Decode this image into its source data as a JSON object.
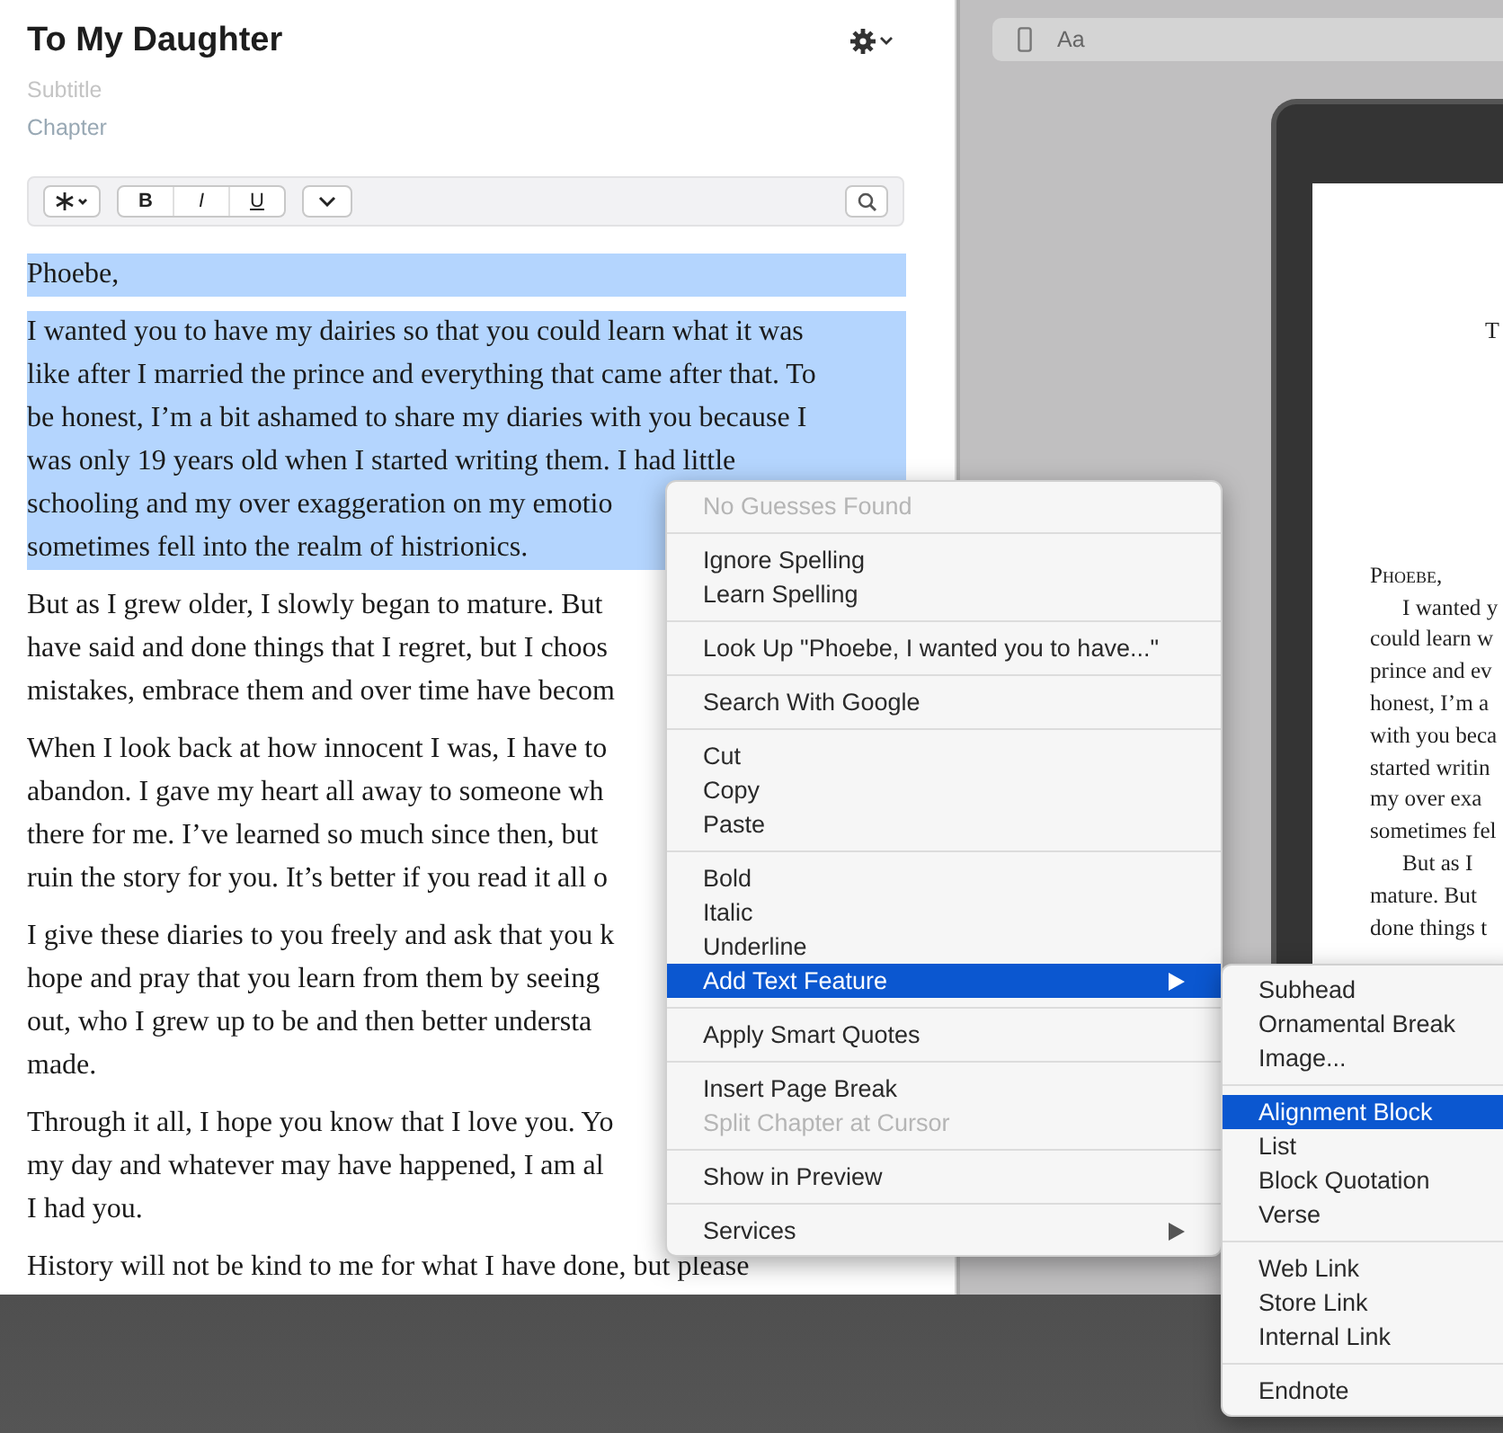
{
  "editor": {
    "title": "To My Daughter",
    "subtitle_placeholder": "Subtitle",
    "chapter": "Chapter",
    "toolbar": {
      "bold": "B",
      "italic": "I",
      "underline": "U"
    },
    "paragraphs": [
      {
        "selected": true,
        "lines": [
          "Phoebe,"
        ]
      },
      {
        "selected": true,
        "lines": [
          "I wanted you to have my dairies so that you could learn what it was",
          "like after I married the prince and everything that came after that. To",
          "be honest, I’m a bit ashamed to share my diaries with you because I",
          "was only 19 years old when I started writing them. I had little",
          "schooling and my over exaggeration on my emotio",
          "sometimes fell into the realm of histrionics."
        ]
      },
      {
        "selected": false,
        "lines": [
          "But as I grew older, I slowly began to mature. But",
          "have said and done things that I regret, but I choos",
          "mistakes, embrace them and over time have becom"
        ]
      },
      {
        "selected": false,
        "lines": [
          "When I look back at how innocent I was, I have to",
          "abandon. I gave my heart all away to someone wh",
          "there for me. I’ve learned so much since then, but",
          "ruin the story for you. It’s better if you read it all o"
        ]
      },
      {
        "selected": false,
        "lines": [
          "I give these diaries to you freely and ask that you k",
          "hope and pray that you learn from them by seeing",
          "out, who I grew up to be and then better understa",
          "made."
        ]
      },
      {
        "selected": false,
        "lines": [
          "Through it all, I hope you know that I love you. Yo",
          "my day and whatever may have happened, I am al",
          "I had you."
        ]
      },
      {
        "selected": false,
        "lines": [
          "History will not be kind to me for what I have done, but please"
        ]
      }
    ]
  },
  "preview": {
    "toolbar_label": "Aa",
    "page_title": "T",
    "salutation": "Phoebe,",
    "paragraphs": [
      {
        "lines": [
          "I wanted y",
          "could learn w",
          "prince and ev",
          "honest, I’m a",
          "with you beca",
          "started writin",
          "my over exa",
          "sometimes fel"
        ]
      },
      {
        "lines": [
          "But as I",
          "mature. But",
          "done things t"
        ]
      }
    ]
  },
  "context_menu": {
    "groups": [
      [
        {
          "label": "No Guesses Found",
          "disabled": true,
          "selected": false,
          "submenu": false
        }
      ],
      [
        {
          "label": "Ignore Spelling",
          "disabled": false,
          "selected": false,
          "submenu": false
        },
        {
          "label": "Learn Spelling",
          "disabled": false,
          "selected": false,
          "submenu": false
        }
      ],
      [
        {
          "label": "Look Up \"Phoebe, I wanted you to have...\"",
          "disabled": false,
          "selected": false,
          "submenu": false
        }
      ],
      [
        {
          "label": "Search With Google",
          "disabled": false,
          "selected": false,
          "submenu": false
        }
      ],
      [
        {
          "label": "Cut",
          "disabled": false,
          "selected": false,
          "submenu": false
        },
        {
          "label": "Copy",
          "disabled": false,
          "selected": false,
          "submenu": false
        },
        {
          "label": "Paste",
          "disabled": false,
          "selected": false,
          "submenu": false
        }
      ],
      [
        {
          "label": "Bold",
          "disabled": false,
          "selected": false,
          "submenu": false
        },
        {
          "label": "Italic",
          "disabled": false,
          "selected": false,
          "submenu": false
        },
        {
          "label": "Underline",
          "disabled": false,
          "selected": false,
          "submenu": false
        },
        {
          "label": "Add Text Feature",
          "disabled": false,
          "selected": true,
          "submenu": true
        }
      ],
      [
        {
          "label": "Apply Smart Quotes",
          "disabled": false,
          "selected": false,
          "submenu": false
        }
      ],
      [
        {
          "label": "Insert Page Break",
          "disabled": false,
          "selected": false,
          "submenu": false
        },
        {
          "label": "Split Chapter at Cursor",
          "disabled": true,
          "selected": false,
          "submenu": false
        }
      ],
      [
        {
          "label": "Show in Preview",
          "disabled": false,
          "selected": false,
          "submenu": false
        }
      ],
      [
        {
          "label": "Services",
          "disabled": false,
          "selected": false,
          "submenu": true
        }
      ]
    ]
  },
  "submenu": {
    "groups": [
      [
        {
          "label": "Subhead",
          "disabled": false,
          "selected": false,
          "submenu": false
        },
        {
          "label": "Ornamental Break",
          "disabled": false,
          "selected": false,
          "submenu": false
        },
        {
          "label": "Image...",
          "disabled": false,
          "selected": false,
          "submenu": false
        }
      ],
      [
        {
          "label": "Alignment Block",
          "disabled": false,
          "selected": true,
          "submenu": false
        },
        {
          "label": "List",
          "disabled": false,
          "selected": false,
          "submenu": false
        },
        {
          "label": "Block Quotation",
          "disabled": false,
          "selected": false,
          "submenu": false
        },
        {
          "label": "Verse",
          "disabled": false,
          "selected": false,
          "submenu": false
        }
      ],
      [
        {
          "label": "Web Link",
          "disabled": false,
          "selected": false,
          "submenu": false
        },
        {
          "label": "Store Link",
          "disabled": false,
          "selected": false,
          "submenu": false
        },
        {
          "label": "Internal Link",
          "disabled": false,
          "selected": false,
          "submenu": false
        }
      ],
      [
        {
          "label": "Endnote",
          "disabled": false,
          "selected": false,
          "submenu": false
        }
      ]
    ]
  }
}
